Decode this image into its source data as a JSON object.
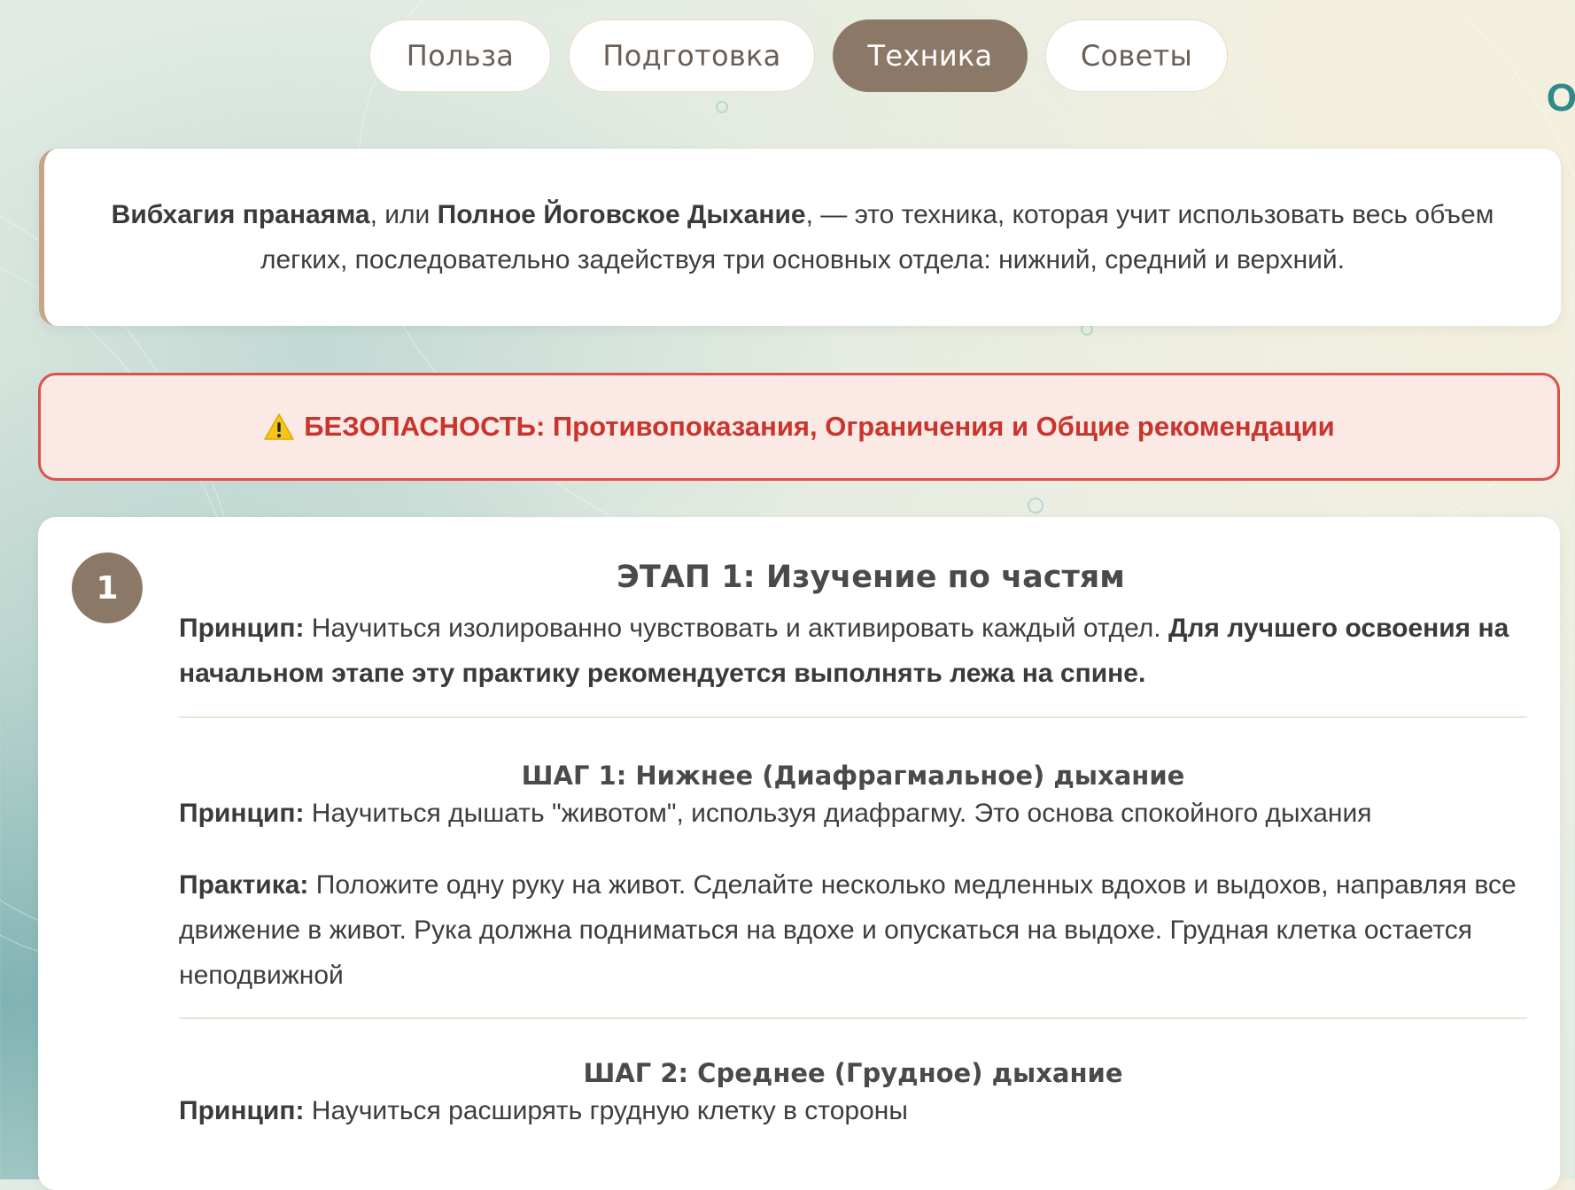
{
  "tabs": [
    {
      "label": "Польза",
      "active": false
    },
    {
      "label": "Подготовка",
      "active": false
    },
    {
      "label": "Техника",
      "active": true
    },
    {
      "label": "Советы",
      "active": false
    }
  ],
  "corner_glyph": "O",
  "intro": {
    "term1": "Вибхагия пранаяма",
    "sep1": ", или ",
    "term2": "Полное Йоговское Дыхание",
    "rest": ", — это техника, которая учит использовать весь объем легких, последовательно задействуя три основных отдела: нижний, средний и верхний."
  },
  "safety": {
    "icon": "warning-icon",
    "text": "БЕЗОПАСНОСТЬ: Противопоказания, Ограничения и Общие рекомендации"
  },
  "stage": {
    "number": "1",
    "title": "ЭТАП 1: Изучение по частям",
    "principle_label": "Принцип:",
    "principle_text": " Научиться изолированно чувствовать и активировать каждый отдел. ",
    "principle_bold": "Для лучшего освоения на начальном этапе эту практику рекомендуется выполнять лежа на спине.",
    "steps": [
      {
        "title": "ШАГ 1: Нижнее (Диафрагмальное) дыхание",
        "principle_label": "Принцип:",
        "principle_text": " Научиться дышать \"животом\", используя диафрагму. Это основа спокойного дыхания",
        "practice_label": "Практика:",
        "practice_text": " Положите одну руку на живот. Сделайте несколько медленных вдохов и выдохов, направляя все движение в живот. Рука должна подниматься на вдохе и опускаться на выдохе. Грудная клетка остается неподвижной"
      },
      {
        "title": "ШАГ 2: Среднее (Грудное) дыхание",
        "principle_label": "Принцип:",
        "principle_text": " Научиться расширять грудную клетку в стороны"
      }
    ]
  },
  "colors": {
    "accent": "#8c7866",
    "warning": "#c9352c",
    "warning_bg": "#fbe9e5"
  }
}
